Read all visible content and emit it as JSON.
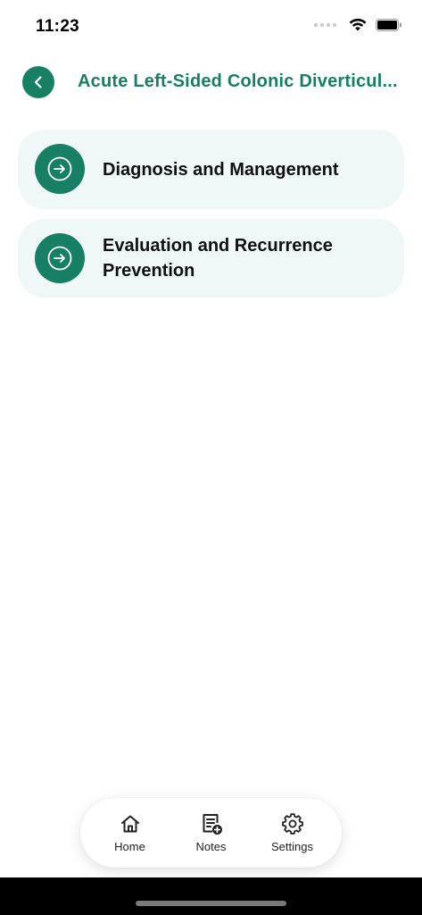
{
  "status_bar": {
    "time": "11:23"
  },
  "header": {
    "title": "Acute Left-Sided Colonic Diverticul..."
  },
  "sections": [
    {
      "label": "Diagnosis and Management"
    },
    {
      "label": "Evaluation and Recurrence Prevention"
    }
  ],
  "tabs": [
    {
      "label": "Home",
      "icon": "home-icon"
    },
    {
      "label": "Notes",
      "icon": "notes-add-icon"
    },
    {
      "label": "Settings",
      "icon": "gear-icon"
    }
  ],
  "colors": {
    "accent": "#167f64",
    "card_bg": "#eff8f6"
  }
}
